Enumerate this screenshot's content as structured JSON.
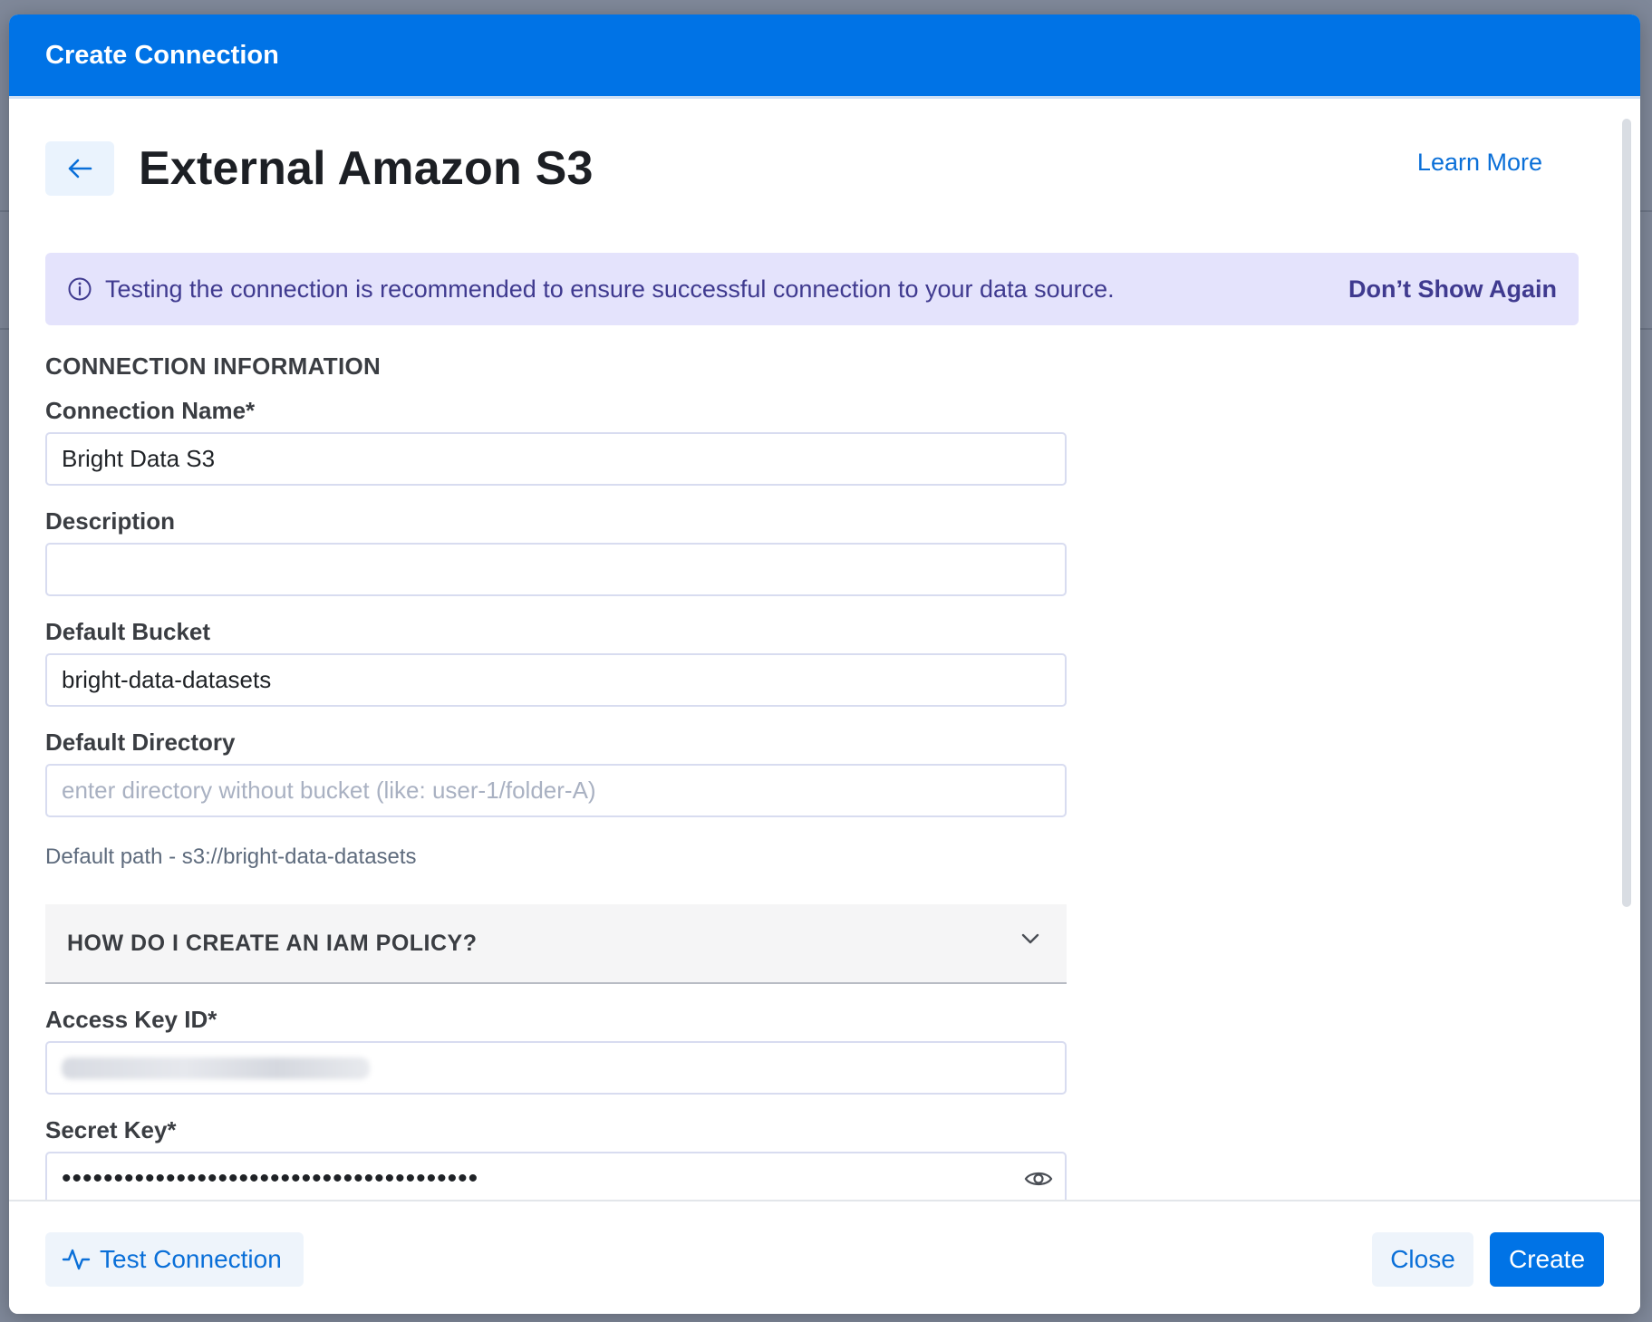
{
  "modal": {
    "header_title": "Create Connection",
    "page_title": "External Amazon S3",
    "learn_more": "Learn More"
  },
  "banner": {
    "message": "Testing the connection is recommended to ensure successful connection to your data source.",
    "dismiss": "Don’t Show Again",
    "icon": "info-circle-icon"
  },
  "section_title": "CONNECTION INFORMATION",
  "fields": {
    "connection_name": {
      "label": "Connection Name*",
      "value": "Bright Data S3"
    },
    "description": {
      "label": "Description",
      "value": ""
    },
    "default_bucket": {
      "label": "Default Bucket",
      "value": "bright-data-datasets"
    },
    "default_directory": {
      "label": "Default Directory",
      "placeholder": "enter directory without bucket (like: user-1/folder-A)"
    },
    "access_key_id": {
      "label": "Access Key ID*"
    },
    "secret_key": {
      "label": "Secret Key*",
      "value": "••••••••••••••••••••••••••••••••••••••••"
    }
  },
  "helper_text": "Default path - s3://bright-data-datasets",
  "accordion": {
    "label": "HOW DO I CREATE AN IAM POLICY?"
  },
  "footer": {
    "test_connection": "Test Connection",
    "close": "Close",
    "create": "Create"
  },
  "colors": {
    "primary": "#0073e6",
    "banner_bg": "#e4e3fc",
    "banner_text": "#3f3a8f",
    "link": "#0a6fd8"
  }
}
